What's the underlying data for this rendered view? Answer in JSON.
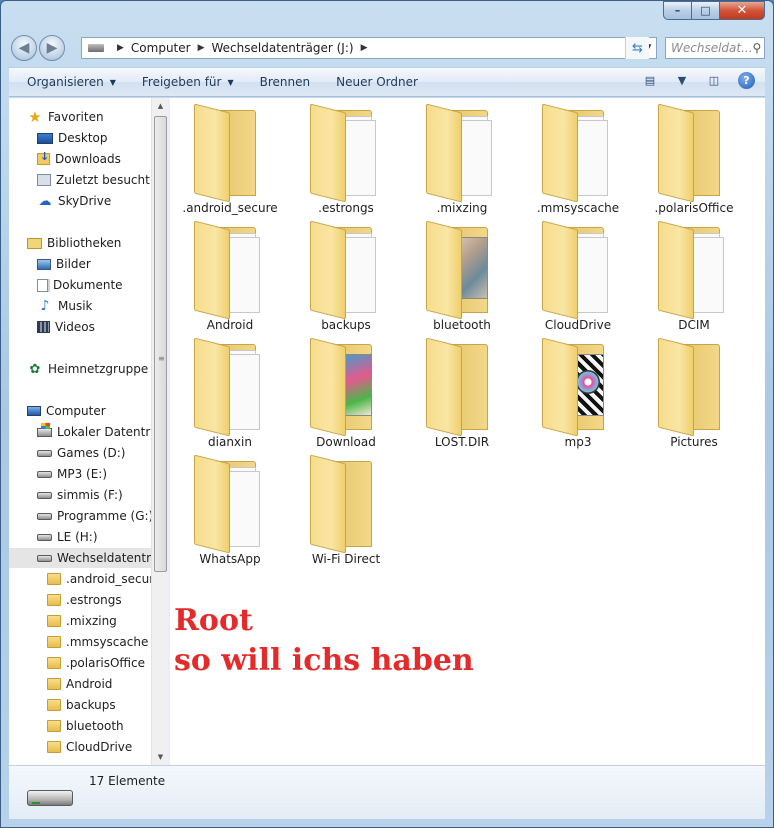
{
  "window": {
    "caption_buttons": [
      "–",
      "□",
      "✕"
    ]
  },
  "address": {
    "crumbs": [
      "Computer",
      "Wechseldatenträger (J:)"
    ],
    "search_placeholder": "Wechseldat..."
  },
  "toolbar": {
    "organize": "Organisieren",
    "share": "Freigeben für",
    "burn": "Brennen",
    "new_folder": "Neuer Ordner"
  },
  "nav": {
    "favorites": {
      "label": "Favoriten",
      "items": [
        "Desktop",
        "Downloads",
        "Zuletzt besucht",
        "SkyDrive"
      ]
    },
    "libraries": {
      "label": "Bibliotheken",
      "items": [
        "Bilder",
        "Dokumente",
        "Musik",
        "Videos"
      ]
    },
    "homegroup": "Heimnetzgruppe",
    "computer": {
      "label": "Computer",
      "drives": [
        "Lokaler Datenträg",
        "Games (D:)",
        "MP3 (E:)",
        "simmis (F:)",
        "Programme (G:)",
        "LE (H:)",
        "Wechseldatenträ"
      ]
    },
    "subfolders": [
      ".android_secure",
      ".estrongs",
      ".mixzing",
      ".mmsyscache",
      ".polarisOffice",
      "Android",
      "backups",
      "bluetooth",
      "CloudDrive"
    ]
  },
  "files": [
    {
      "name": ".android_secure",
      "style": "empty"
    },
    {
      "name": ".estrongs",
      "style": "papers"
    },
    {
      "name": ".mixzing",
      "style": "papers"
    },
    {
      "name": ".mmsyscache",
      "style": "papers"
    },
    {
      "name": ".polarisOffice",
      "style": "empty"
    },
    {
      "name": "Android",
      "style": "papers"
    },
    {
      "name": "backups",
      "style": "papers"
    },
    {
      "name": "bluetooth",
      "style": "photo"
    },
    {
      "name": "CloudDrive",
      "style": "papers"
    },
    {
      "name": "DCIM",
      "style": "papers"
    },
    {
      "name": "dianxin",
      "style": "papers"
    },
    {
      "name": "Download",
      "style": "download"
    },
    {
      "name": "LOST.DIR",
      "style": "empty"
    },
    {
      "name": "mp3",
      "style": "mp3"
    },
    {
      "name": "Pictures",
      "style": "empty"
    },
    {
      "name": "WhatsApp",
      "style": "papers"
    },
    {
      "name": "Wi-Fi Direct",
      "style": "empty"
    }
  ],
  "annotation": {
    "line1": "Root",
    "line2": "so will ichs haben"
  },
  "status": {
    "count": "17 Elemente"
  },
  "colors": {
    "annotation": "#e32b2b",
    "toolbar_text": "#1e395b"
  }
}
